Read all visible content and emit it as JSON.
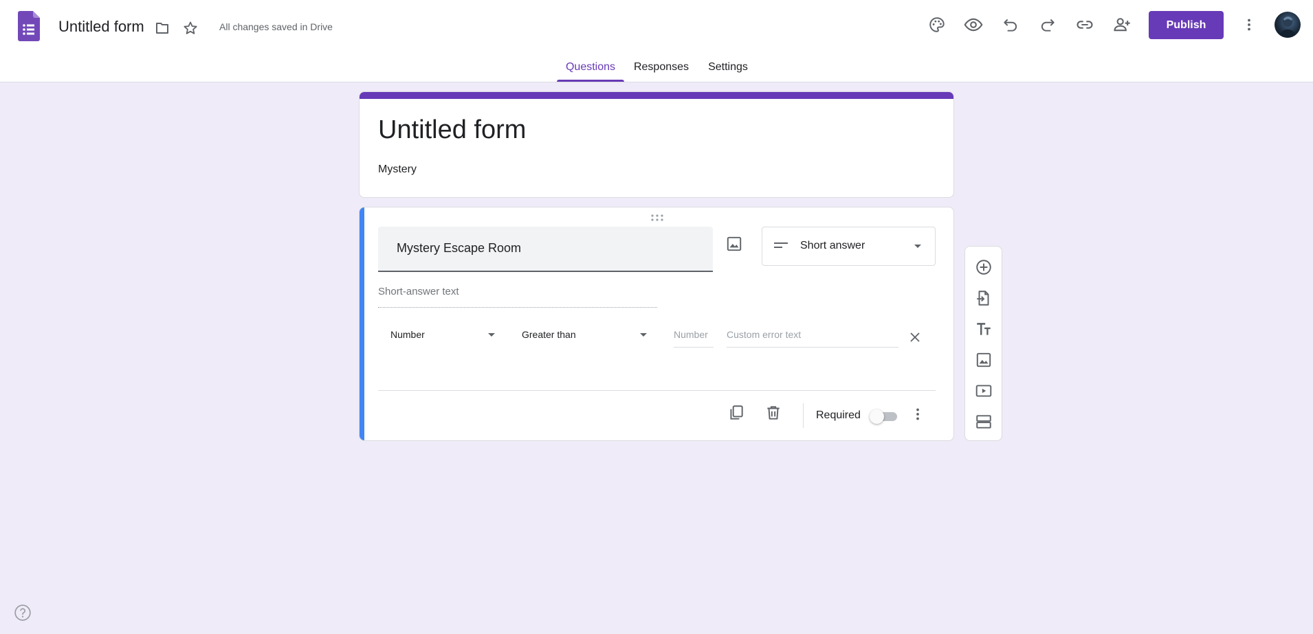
{
  "header": {
    "form_title": "Untitled form",
    "saved_status": "All changes saved in Drive",
    "publish_label": "Publish",
    "icons": [
      "forms-logo",
      "folder-icon",
      "star-icon",
      "palette-icon",
      "preview-icon",
      "undo-icon",
      "redo-icon",
      "link-icon",
      "add-collaborator-icon",
      "more-vert-icon"
    ]
  },
  "tabs": [
    {
      "label": "Questions",
      "active": true
    },
    {
      "label": "Responses",
      "active": false
    },
    {
      "label": "Settings",
      "active": false
    }
  ],
  "form": {
    "title": "Untitled form",
    "description": "Mystery"
  },
  "question": {
    "title": "Mystery Escape Room",
    "type": "Short answer",
    "answer_placeholder": "Short-answer text",
    "validation": {
      "category": "Number",
      "condition": "Greater than",
      "value_placeholder": "Number",
      "error_placeholder": "Custom error text"
    },
    "required_label": "Required",
    "required": false
  },
  "side_toolbar": [
    "add-question-icon",
    "import-questions-icon",
    "add-title-icon",
    "add-image-icon",
    "add-video-icon",
    "add-section-icon"
  ],
  "colors": {
    "brand_purple": "#673ab7",
    "question_accent": "#4285f4",
    "page_background": "#f0ebf8"
  }
}
